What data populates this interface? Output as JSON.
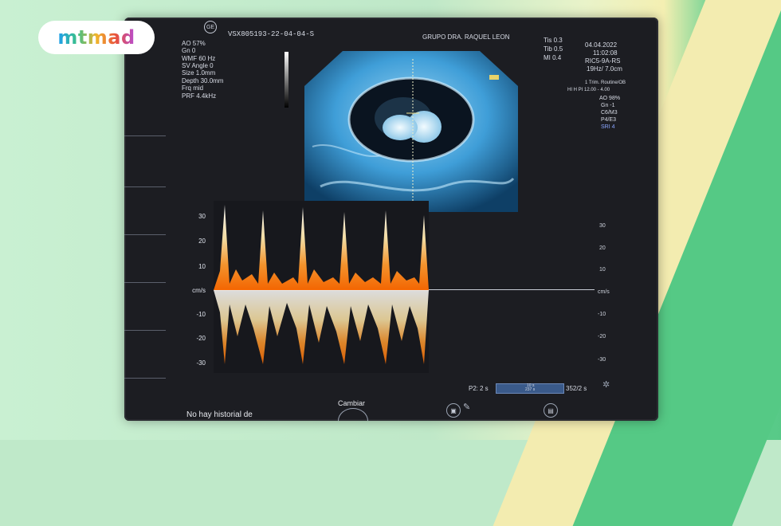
{
  "logo": {
    "text": "mtmad"
  },
  "header": {
    "patient_id": "VSX805193-22-04-04-S",
    "clinic": "GRUPO DRA. RAQUEL LEON",
    "ti_s": "Tis 0.3",
    "ti_b": "Tib 0.5",
    "mi": "MI 0.4",
    "date": "04.04.2022",
    "time": "11:02:08",
    "probe": "RIC5-9A-RS",
    "freq": "19Hz/ 7.0cm"
  },
  "left_params": [
    "AO 57%",
    "Gn  0",
    "WMF 60 Hz",
    "SV Angle  0",
    "Size  1.0mm",
    "Depth 30.0mm",
    "Frq mid",
    "PRF 4.4kHz"
  ],
  "right_params": [
    "1 Trim. Routine/OB",
    "HI H PI 12.00 - 4.00",
    "AO 98%",
    "Gn -1",
    "C6/M3",
    "P4/E3",
    "SRI 4"
  ],
  "left_axis": [
    "30",
    "20",
    "10",
    "cm/s",
    "-10",
    "-20",
    "-30"
  ],
  "right_axis": [
    "30",
    "20",
    "10",
    "cm/s",
    "-10",
    "-20",
    "-30"
  ],
  "bottom": {
    "p2": "P2:",
    "p2_value": "2 s",
    "time_left": "10 s",
    "time_right": "352/2 s",
    "bar_top": "10 s",
    "bar_bottom": "237 s",
    "cambiar": "Cambiar",
    "history": "No hay historial de"
  },
  "icons": [
    "ge-logo-icon",
    "settings-icon",
    "scan-button-icon",
    "pen-icon",
    "print-icon"
  ],
  "colors": {
    "doppler_core": "#fff6d8",
    "doppler_edge": "#ff8a1e",
    "screen": "#1c1d22"
  }
}
